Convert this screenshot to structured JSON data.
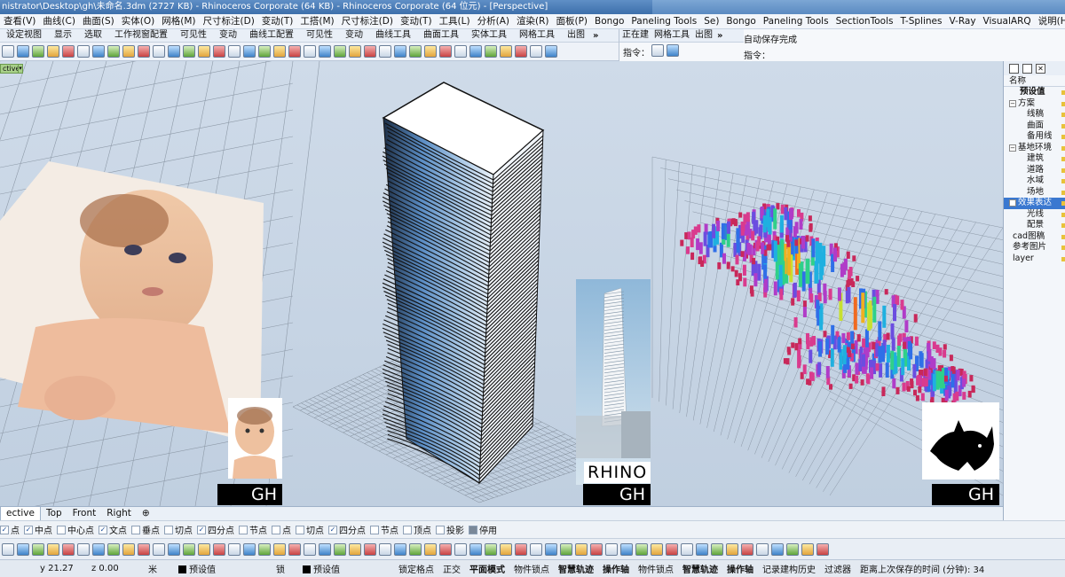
{
  "window": {
    "title": "nistrator\\Desktop\\gh\\未命名.3dm (2727 KB) - Rhinoceros Corporate (64 KB) - Rhinoceros Corporate (64 位元) - [Perspective]"
  },
  "menu": [
    "查看(V)",
    "曲线(C)",
    "曲面(S)",
    "实体(O)",
    "网格(M)",
    "尺寸标注(D)",
    "变动(T)",
    "工搭(M)",
    "尺寸标注(D)",
    "变动(T)",
    "工具(L)",
    "分析(A)",
    "渲染(R)",
    "面板(P)",
    "Bongo",
    "Paneling Tools",
    "Se)",
    "Bongo",
    "Paneling Tools",
    "SectionTools",
    "T-Splines",
    "V-Ray",
    "VisualARQ",
    "说明(H)"
  ],
  "toolbar_tabs_left": [
    "设定视图",
    "显示",
    "选取",
    "工作视窗配置",
    "可见性",
    "变动",
    "曲线工配置",
    "可见性",
    "变动",
    "曲线工具",
    "曲面工具",
    "实体工具",
    "网格工具",
    "出图"
  ],
  "toolbar_tabs_right": [
    "正在建",
    "网格工具",
    "出图"
  ],
  "toolbar_more": "»",
  "command": {
    "history_1": "自动保存完成",
    "prompt_left": "指令：",
    "prompt_right": "指令："
  },
  "viewport": {
    "label": "ctive",
    "label_arrow": "▾",
    "gh_label": "GH",
    "rhino_label": "RHINO",
    "colors": {
      "background": "#c7d5e6",
      "grid": "#8e9aa8",
      "tower_body": "#5b8dc4"
    }
  },
  "view_tabs": [
    "ective",
    "Top",
    "Front",
    "Right",
    "⊕"
  ],
  "layers": {
    "header": "名称",
    "rows": [
      {
        "label": "预设值",
        "indent": 1,
        "expand": "",
        "bold": true
      },
      {
        "label": "方案",
        "indent": 0,
        "expand": "−"
      },
      {
        "label": "线稿",
        "indent": 2,
        "expand": ""
      },
      {
        "label": "曲面",
        "indent": 2,
        "expand": ""
      },
      {
        "label": "备用线",
        "indent": 2,
        "expand": ""
      },
      {
        "label": "基地环境",
        "indent": 0,
        "expand": "−"
      },
      {
        "label": "建筑",
        "indent": 2,
        "expand": ""
      },
      {
        "label": "道路",
        "indent": 2,
        "expand": ""
      },
      {
        "label": "水域",
        "indent": 2,
        "expand": ""
      },
      {
        "label": "场地",
        "indent": 2,
        "expand": ""
      },
      {
        "label": "效果表达",
        "indent": 0,
        "expand": "−",
        "selected": true
      },
      {
        "label": "光线",
        "indent": 2,
        "expand": ""
      },
      {
        "label": "配景",
        "indent": 2,
        "expand": ""
      },
      {
        "label": "cad图稿",
        "indent": 1,
        "expand": ""
      },
      {
        "label": "参考图片",
        "indent": 1,
        "expand": ""
      },
      {
        "label": "layer",
        "indent": 1,
        "expand": ""
      }
    ]
  },
  "osnaps": [
    {
      "label": "点",
      "checked": true
    },
    {
      "label": "中点",
      "checked": true
    },
    {
      "label": "中心点",
      "checked": false
    },
    {
      "label": "文点",
      "checked": true
    },
    {
      "label": "垂点",
      "checked": false
    },
    {
      "label": "切点",
      "checked": false
    },
    {
      "label": "四分点",
      "checked": true
    },
    {
      "label": "节点",
      "checked": false
    },
    {
      "label": "点",
      "checked": false
    },
    {
      "label": "切点",
      "checked": false
    },
    {
      "label": "四分点",
      "checked": true
    },
    {
      "label": "节点",
      "checked": false
    },
    {
      "label": "顶点",
      "checked": false
    },
    {
      "label": "投影",
      "checked": false
    },
    {
      "label": "停用",
      "checked": false,
      "gray": true
    }
  ],
  "status": {
    "y": "y 21.27",
    "z": "z 0.00",
    "unit": "米",
    "layer1": "预设值",
    "lock": "锁",
    "layer2": "预设值",
    "items": [
      "锁定格点",
      "正交",
      "平面模式",
      "物件锁点",
      "智慧轨迹",
      "操作轴",
      "物件锁点",
      "智慧轨迹",
      "操作轴",
      "记录建构历史",
      "过滤器",
      "距离上次保存的时间 (分钟): 34"
    ],
    "bold_items": [
      "平面模式",
      "智慧轨迹",
      "操作轴"
    ]
  }
}
